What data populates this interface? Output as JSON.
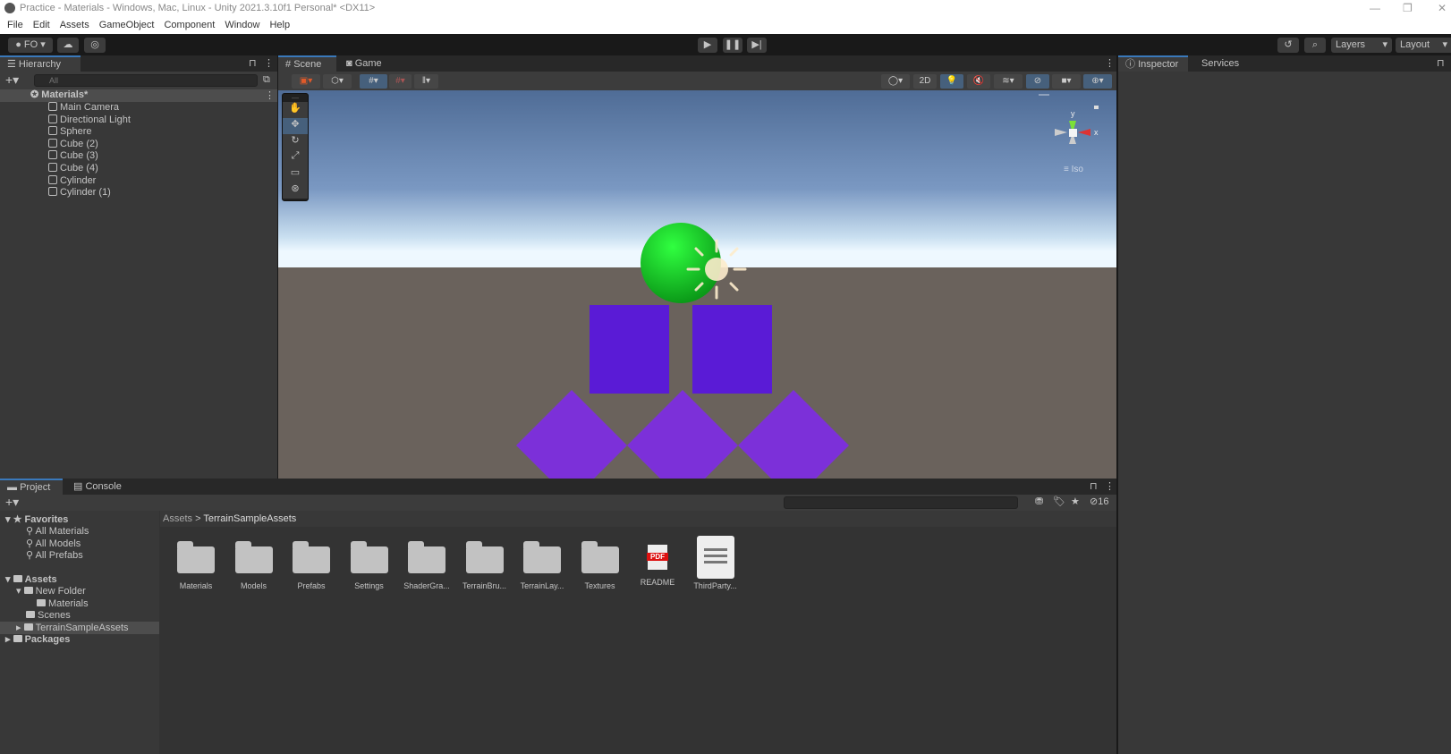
{
  "window": {
    "title": "Practice - Materials - Windows, Mac, Linux - Unity 2021.3.10f1 Personal* <DX11>"
  },
  "menu": [
    "File",
    "Edit",
    "Assets",
    "GameObject",
    "Component",
    "Window",
    "Help"
  ],
  "toolbar": {
    "account": "FO",
    "layers": "Layers",
    "layout": "Layout"
  },
  "hierarchy": {
    "tab": "Hierarchy",
    "search_placeholder": "All",
    "scene": "Materials*",
    "items": [
      "Main Camera",
      "Directional Light",
      "Sphere",
      "Cube (2)",
      "Cube (3)",
      "Cube (4)",
      "Cylinder",
      "Cylinder (1)"
    ]
  },
  "scene": {
    "tabs": [
      "Scene",
      "Game"
    ],
    "mode_2d": "2D",
    "gizmo": {
      "y": "y",
      "x": "x",
      "projection": "Iso"
    },
    "colors": {
      "sphere": "#16c626",
      "cube": "#5a1bd6",
      "diamond": "#7c30d9",
      "sky": "#5d7aa3",
      "ground": "#6a625c"
    }
  },
  "inspector": {
    "tabs": [
      "Inspector",
      "Services"
    ]
  },
  "project": {
    "tabs": [
      "Project",
      "Console"
    ],
    "favorites": {
      "label": "Favorites",
      "items": [
        "All Materials",
        "All Models",
        "All Prefabs"
      ]
    },
    "assets": {
      "label": "Assets",
      "items": [
        {
          "label": "New Folder"
        },
        {
          "label": "Materials"
        },
        {
          "label": "Scenes"
        },
        {
          "label": "TerrainSampleAssets"
        }
      ]
    },
    "packages": "Packages",
    "breadcrumb": [
      "Assets",
      "TerrainSampleAssets"
    ],
    "hidden_count": "16",
    "files": [
      "Materials",
      "Models",
      "Prefabs",
      "Settings",
      "ShaderGra...",
      "TerrainBru...",
      "TerrainLay...",
      "Textures",
      "README",
      "ThirdParty..."
    ],
    "pdf_badge": "PDF"
  }
}
